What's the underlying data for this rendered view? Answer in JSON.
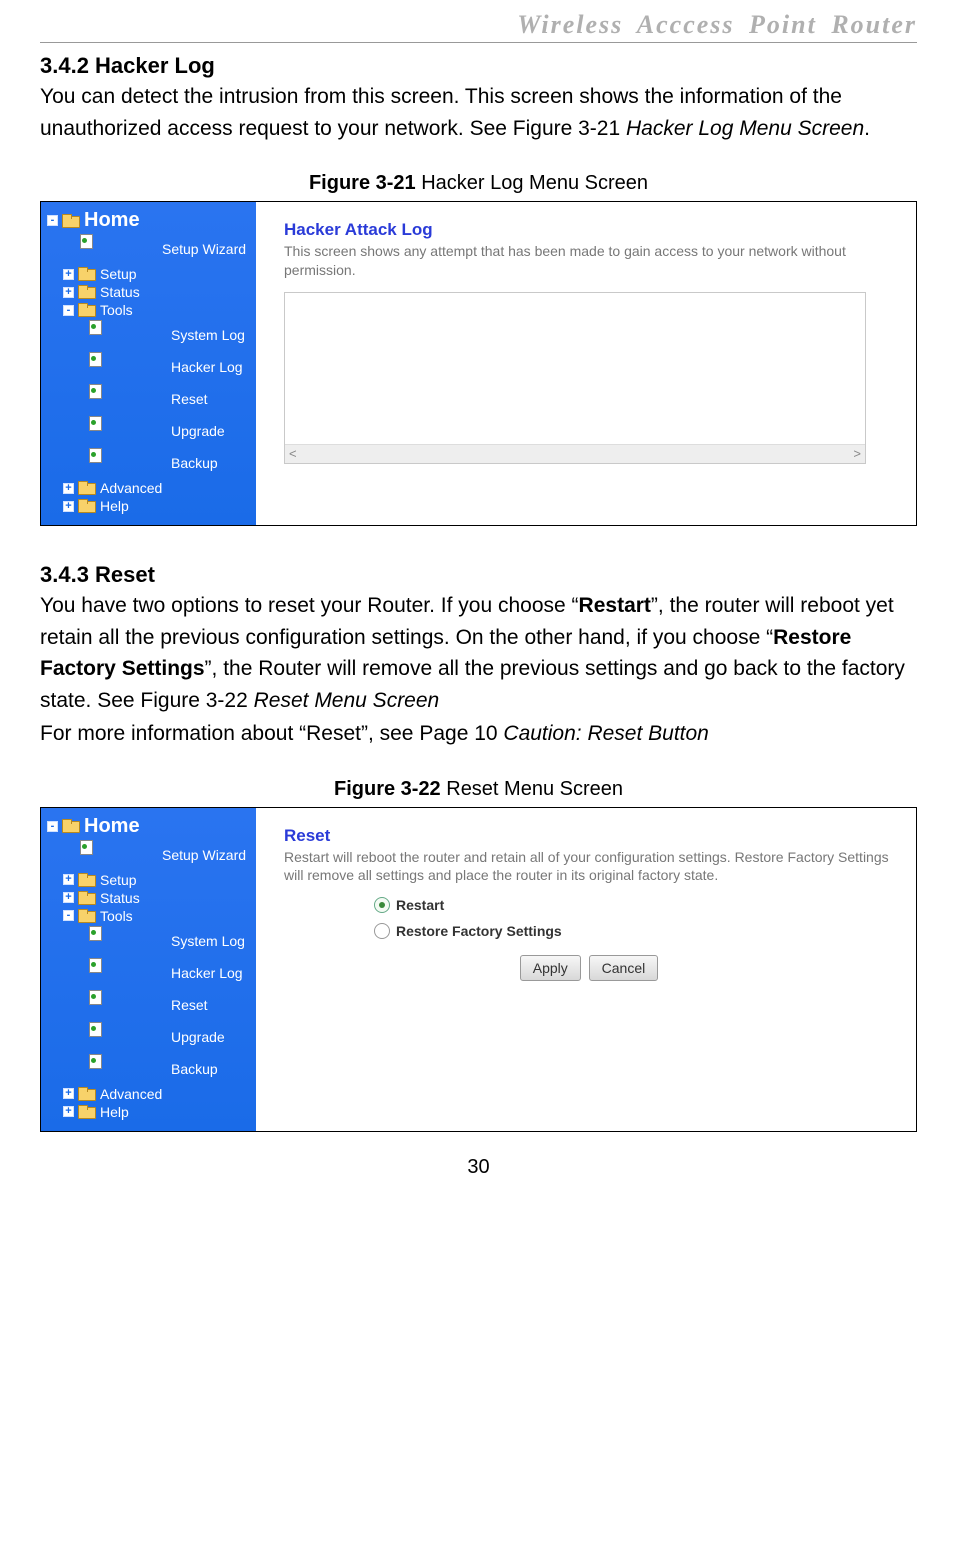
{
  "header": {
    "title": "Wireless  Acccess  Point  Router"
  },
  "section1": {
    "heading": "3.4.2 Hacker Log",
    "para_pre": "You can detect the intrusion from this screen. This screen shows the information of the unauthorized access request to your network. See Figure 3-21 ",
    "para_italic": "Hacker Log Menu Screen",
    "para_post": "."
  },
  "figure1": {
    "caption_bold": "Figure 3-21",
    "caption_rest": " Hacker Log Menu Screen",
    "panel_title": "Hacker Attack Log",
    "panel_desc": "This screen shows any attempt that has been made to gain access to your network without permission.",
    "scroll_left": "<",
    "scroll_right": ">"
  },
  "sidebar1": {
    "home": "Home",
    "items": [
      {
        "label": "Setup Wizard",
        "type": "page",
        "exp": ""
      },
      {
        "label": "Setup",
        "type": "folder",
        "exp": "+"
      },
      {
        "label": "Status",
        "type": "folder",
        "exp": "+"
      },
      {
        "label": "Tools",
        "type": "folder",
        "exp": "-"
      }
    ],
    "tools_children": [
      {
        "label": "System Log"
      },
      {
        "label": "Hacker Log"
      },
      {
        "label": "Reset"
      },
      {
        "label": "Upgrade"
      },
      {
        "label": "Backup"
      }
    ],
    "tail": [
      {
        "label": "Advanced",
        "exp": "+"
      },
      {
        "label": "Help",
        "exp": "+"
      }
    ]
  },
  "section2": {
    "heading": "3.4.3 Reset",
    "p1_a": "You have two options to reset your Router. If you choose “",
    "p1_b_bold": "Restart",
    "p1_c": "”, the router will reboot yet retain all the previous configuration settings. On the other hand, if you choose “",
    "p1_d_bold": "Restore Factory Settings",
    "p1_e": "”, the Router will remove all the previous settings and go back to the factory state. See Figure 3-22 ",
    "p1_f_italic": "Reset Menu Screen",
    "p2_a": "For more information about “Reset”, see Page 10 ",
    "p2_b_italic": "Caution: Reset Button"
  },
  "figure2": {
    "caption_bold": "Figure 3-22",
    "caption_rest": " Reset Menu Screen",
    "panel_title": "Reset",
    "panel_desc": "Restart will reboot the router and retain all of your configuration settings. Restore Factory Settings will remove all settings and place the router in its original factory state.",
    "radio1": "Restart",
    "radio2": "Restore Factory Settings",
    "btn_apply": "Apply",
    "btn_cancel": "Cancel"
  },
  "page_number": "30"
}
